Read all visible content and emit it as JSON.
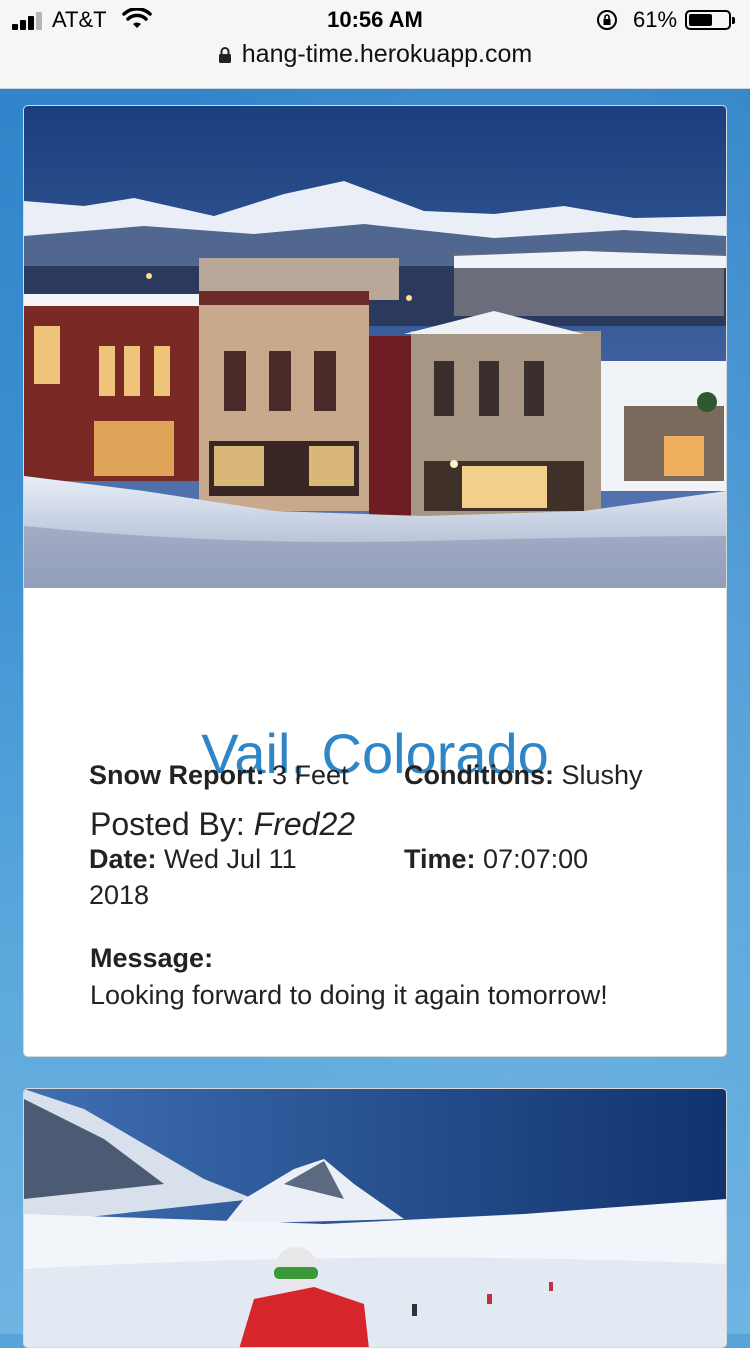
{
  "status_bar": {
    "carrier": "AT&T",
    "time": "10:56 AM",
    "battery_percent": "61%",
    "battery_level": 0.61
  },
  "browser": {
    "url": "hang-time.herokuapp.com"
  },
  "posts": [
    {
      "title": "Vail, Colorado",
      "posted_by_label": "Posted By:",
      "author": "Fred22",
      "snow_report_label": "Snow Report:",
      "snow_report_value": "3 Feet",
      "conditions_label": "Conditions:",
      "conditions_value": "Slushy",
      "date_label": "Date:",
      "date_value": "Wed Jul 11 2018",
      "time_label": "Time:",
      "time_value": "07:07:00",
      "message_label": "Message:",
      "message_value": "Looking forward to doing it again tomorrow!"
    }
  ],
  "colors": {
    "title": "#2f86c6",
    "background": "#3a8ed0"
  }
}
